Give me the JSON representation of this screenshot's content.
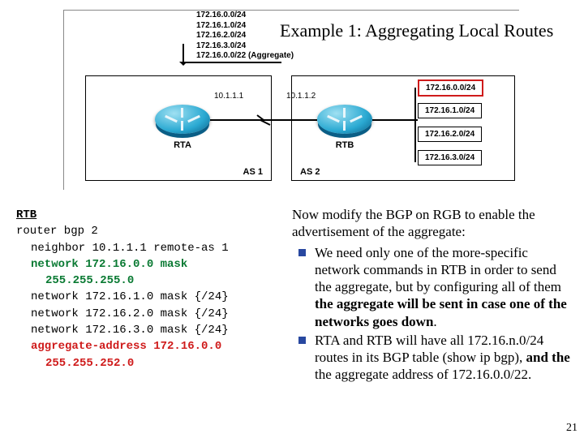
{
  "title": "Example 1: Aggregating Local Routes",
  "diagram": {
    "local_routes": [
      "172.16.0.0/24",
      "172.16.1.0/24",
      "172.16.2.0/24",
      "172.16.3.0/24",
      "172.16.0.0/22 (Aggregate)"
    ],
    "ip_left": "10.1.1.1",
    "ip_right": "10.1.1.2",
    "rta_name": "RTA",
    "rtb_name": "RTB",
    "as1_label": "AS 1",
    "as2_label": "AS 2",
    "rtb_nets": [
      "172.16.0.0/24",
      "172.16.1.0/24",
      "172.16.2.0/24",
      "172.16.3.0/24"
    ]
  },
  "config": {
    "header": "RTB",
    "lines": {
      "l0": "router bgp 2",
      "l1": "neighbor 10.1.1.1 remote-as 1",
      "l2": "network 172.16.0.0 mask",
      "l2b": "255.255.255.0",
      "l3": "network 172.16.1.0 mask {/24}",
      "l4": "network 172.16.2.0 mask {/24}",
      "l5": "network 172.16.3.0 mask {/24}",
      "l6": "aggregate-address 172.16.0.0",
      "l6b": "255.255.252.0"
    }
  },
  "prose": {
    "lead_a": "Now modify the BGP on RGB to enable the advertisement of the aggregate:",
    "b1_a": "We need only one of the more-specific network commands in RTB in order to send the aggregate, but by configuring all of them ",
    "b1_b": "the aggregate will be sent in case one of the networks goes down",
    "b1_c": ".",
    "b2_a": "RTA  and RTB will have all 172.16.n.0/24 routes in its BGP table (show ip bgp), ",
    "b2_b": "and the",
    "b2_c": " the aggregate address of 172.16.0.0/22."
  },
  "page_number": "21"
}
